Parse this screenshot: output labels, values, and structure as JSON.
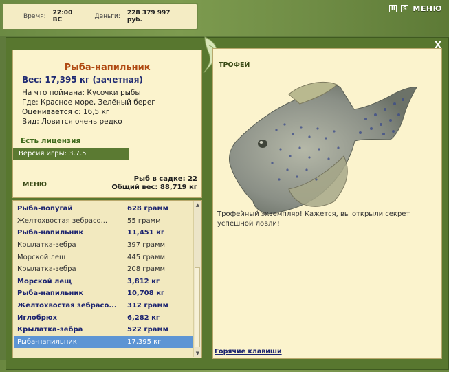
{
  "status": {
    "time_label": "Время:",
    "time_value": "22:00 ВС",
    "money_label": "Деньги:",
    "money_value": "228 379 997 руб."
  },
  "topbar": {
    "pause_label": "II",
    "sound_label": "S",
    "menu_label": "МЕНЮ"
  },
  "dialog": {
    "close_label": "X"
  },
  "fish_info": {
    "title": "Рыба-напильник",
    "weight": "Вес: 17,395 кг (зачетная)",
    "bait": "На что поймана: Кусочки рыбы",
    "location": "Где: Красное море, Зелёный берег",
    "price": "Оценивается с: 16,5 кг",
    "rarity": "Вид: Ловится очень редко",
    "license": "Есть лицензия",
    "version": "Версия игры: 3.7.5",
    "menu_link": "МЕНЮ",
    "in_net": "Рыб в садке: 22",
    "total_weight": "Общий вес: 88,719 кг"
  },
  "catch_list": [
    {
      "name": "Рыба-попугай",
      "weight": "628 грамм",
      "style": "bold"
    },
    {
      "name": "Желтохвостая зебрасо...",
      "weight": "55 грамм",
      "style": "plain"
    },
    {
      "name": "Рыба-напильник",
      "weight": "11,451 кг",
      "style": "bold"
    },
    {
      "name": "Крылатка-зебра",
      "weight": "397 грамм",
      "style": "plain"
    },
    {
      "name": "Морской лещ",
      "weight": "445 грамм",
      "style": "plain"
    },
    {
      "name": "Крылатка-зебра",
      "weight": "208 грамм",
      "style": "plain"
    },
    {
      "name": "Морской лещ",
      "weight": "3,812 кг",
      "style": "bold"
    },
    {
      "name": "Рыба-напильник",
      "weight": "10,708 кг",
      "style": "bold"
    },
    {
      "name": "Желтохвостая зебрасо...",
      "weight": "312 грамм",
      "style": "bold"
    },
    {
      "name": "Иглобрюх",
      "weight": "6,282 кг",
      "style": "bold"
    },
    {
      "name": "Крылатка-зебра",
      "weight": "522 грамм",
      "style": "bold"
    },
    {
      "name": "Рыба-напильник",
      "weight": "17,395 кг",
      "style": "sel"
    }
  ],
  "trophy": {
    "title": "ТРОФЕЙ",
    "text": "Трофейный экземпляр! Кажется, вы открыли секрет успешной ловли!",
    "hotkeys": "Горячие клавиши"
  },
  "colors": {
    "frame_green": "#58772f",
    "panel_cream": "#fbf3cd",
    "title_orange": "#b04a12",
    "bold_blue": "#1c2470",
    "selection_blue": "#5d95d4"
  },
  "icons": [
    "pause-icon",
    "sound-icon",
    "close-icon",
    "fish-emblem-icon",
    "scroll-up-icon",
    "scroll-down-icon"
  ]
}
